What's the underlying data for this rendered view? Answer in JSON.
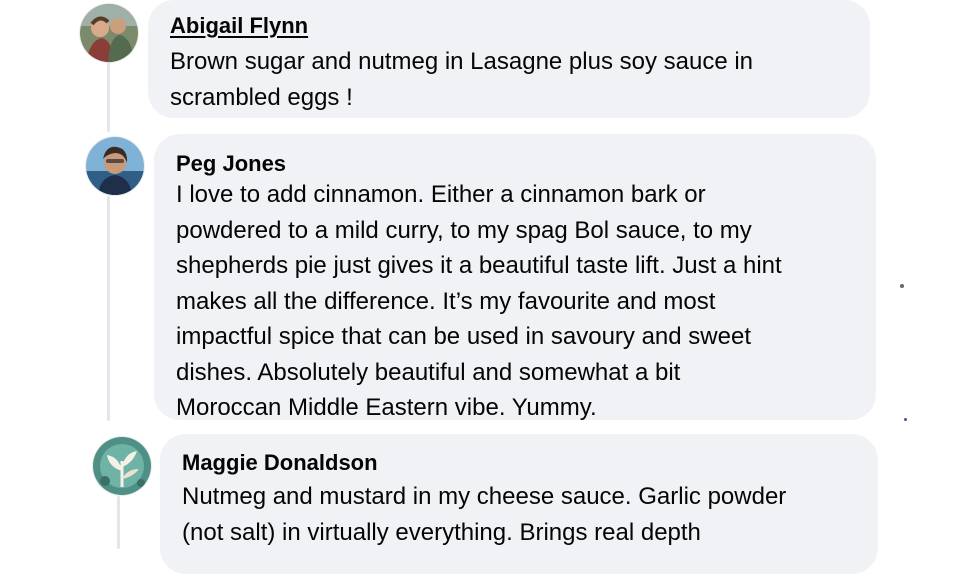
{
  "comments": [
    {
      "author": "Abigail Flynn",
      "avatar_icon": "profile-photo-icon",
      "lines": [
        "Brown sugar and nutmeg in Lasagne plus soy sauce in",
        "scrambled eggs !"
      ]
    },
    {
      "author": "Peg Jones",
      "avatar_icon": "profile-photo-icon",
      "lines": [
        "I love to add cinnamon. Either a cinnamon bark or",
        "powdered to a mild curry, to my spag Bol sauce, to my",
        "shepherds pie just gives it a beautiful taste lift. Just a hint",
        "makes all the difference. It’s my favourite and most",
        "impactful spice that can be used in savoury and sweet",
        "dishes. Absolutely beautiful and somewhat a bit",
        "Moroccan Middle Eastern vibe. Yummy."
      ]
    },
    {
      "author": "Maggie Donaldson",
      "avatar_icon": "leaf-pattern-icon",
      "lines": [
        "Nutmeg and mustard in my cheese sauce. Garlic powder",
        "(not salt) in virtually everything. Brings real depth"
      ]
    }
  ],
  "colors": {
    "bubble": "#f0f2f5",
    "text": "#050505",
    "thread_line": "#e4e6eb"
  }
}
